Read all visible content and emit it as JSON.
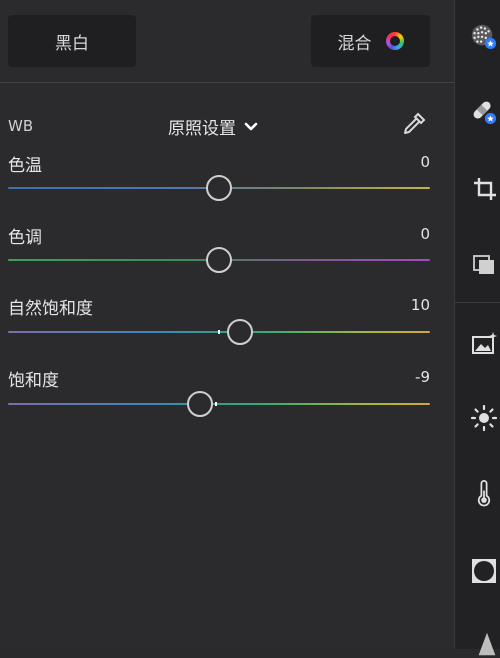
{
  "header": {
    "bw_label": "黑白",
    "mix_label": "混合"
  },
  "wb": {
    "label": "WB",
    "preset": "原照设置"
  },
  "sliders": [
    {
      "label": "色温",
      "value": "0",
      "position": 0.5
    },
    {
      "label": "色调",
      "value": "0",
      "position": 0.5
    },
    {
      "label": "自然饱和度",
      "value": "10",
      "position": 0.55
    },
    {
      "label": "饱和度",
      "value": "-9",
      "position": 0.455
    }
  ],
  "sidebar_icons": [
    "color-dots-icon",
    "healing-bandage-icon",
    "crop-rotate-icon",
    "layers-icon",
    "image-effect-icon",
    "brightness-icon",
    "thermometer-icon",
    "vignette-icon",
    "more-icon"
  ],
  "colors": {
    "background": "#2b2b2d",
    "button_bg": "#1f1f21",
    "accent_blue": "#2f7bff"
  }
}
